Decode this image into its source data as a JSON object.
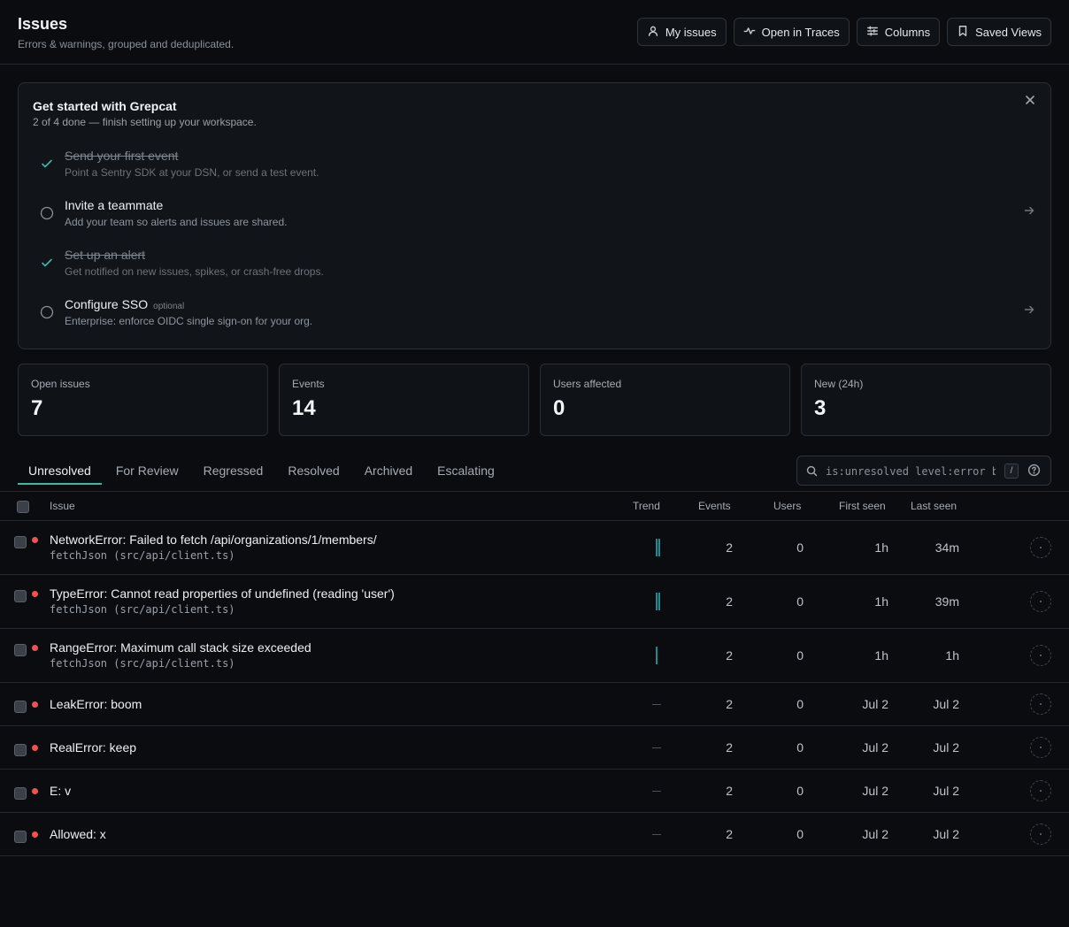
{
  "header": {
    "title": "Issues",
    "subtitle": "Errors & warnings, grouped and deduplicated.",
    "buttons": {
      "my_issues": "My issues",
      "open_in_traces": "Open in Traces",
      "columns": "Columns",
      "saved_views": "Saved Views"
    }
  },
  "onboarding": {
    "title": "Get started with Grepcat",
    "subtitle": "2 of 4 done — finish setting up your workspace.",
    "steps": [
      {
        "title": "Send your first event",
        "desc": "Point a Sentry SDK at your DSN, or send a test event.",
        "done": true
      },
      {
        "title": "Invite a teammate",
        "desc": "Add your team so alerts and issues are shared.",
        "done": false
      },
      {
        "title": "Set up an alert",
        "desc": "Get notified on new issues, spikes, or crash-free drops.",
        "done": true
      },
      {
        "title": "Configure SSO",
        "optional": "optional",
        "desc": "Enterprise: enforce OIDC single sign-on for your org.",
        "done": false
      }
    ]
  },
  "stats": [
    {
      "label": "Open issues",
      "value": "7"
    },
    {
      "label": "Events",
      "value": "14"
    },
    {
      "label": "Users affected",
      "value": "0"
    },
    {
      "label": "New (24h)",
      "value": "3"
    }
  ],
  "tabs": [
    "Unresolved",
    "For Review",
    "Regressed",
    "Resolved",
    "Archived",
    "Escalating"
  ],
  "active_tab": "Unresolved",
  "search": {
    "value": "is:unresolved level:error b",
    "shortcut": "/"
  },
  "table": {
    "columns": {
      "issue": "Issue",
      "trend": "Trend",
      "events": "Events",
      "users": "Users",
      "first_seen": "First seen",
      "last_seen": "Last seen"
    },
    "rows": [
      {
        "title": "NetworkError: Failed to fetch /api/organizations/1/members/",
        "culprit": "fetchJson (src/api/client.ts)",
        "trend_bars": 2,
        "events": "2",
        "users": "0",
        "first_seen": "1h",
        "last_seen": "34m"
      },
      {
        "title": "TypeError: Cannot read properties of undefined (reading 'user')",
        "culprit": "fetchJson (src/api/client.ts)",
        "trend_bars": 2,
        "events": "2",
        "users": "0",
        "first_seen": "1h",
        "last_seen": "39m"
      },
      {
        "title": "RangeError: Maximum call stack size exceeded",
        "culprit": "fetchJson (src/api/client.ts)",
        "trend_bars": 1,
        "events": "2",
        "users": "0",
        "first_seen": "1h",
        "last_seen": "1h"
      },
      {
        "title": "LeakError: boom",
        "culprit": "",
        "trend_bars": 0,
        "events": "2",
        "users": "0",
        "first_seen": "Jul 2",
        "last_seen": "Jul 2"
      },
      {
        "title": "RealError: keep",
        "culprit": "",
        "trend_bars": 0,
        "events": "2",
        "users": "0",
        "first_seen": "Jul 2",
        "last_seen": "Jul 2"
      },
      {
        "title": "E: v",
        "culprit": "",
        "trend_bars": 0,
        "events": "2",
        "users": "0",
        "first_seen": "Jul 2",
        "last_seen": "Jul 2"
      },
      {
        "title": "Allowed: x",
        "culprit": "",
        "trend_bars": 0,
        "events": "2",
        "users": "0",
        "first_seen": "Jul 2",
        "last_seen": "Jul 2"
      }
    ]
  },
  "colors": {
    "background": "#0a0c10",
    "accent": "#3fb8a6",
    "error_dot": "#f05252",
    "trend_bar": "#1f8a91",
    "check": "#3fb8a6"
  },
  "icons": {
    "my_issues": "user-icon",
    "open_in_traces": "activity-icon",
    "columns": "sliders-icon",
    "saved_views": "bookmark-icon",
    "close": "close-icon",
    "search": "search-icon",
    "help": "help-circle-icon"
  }
}
